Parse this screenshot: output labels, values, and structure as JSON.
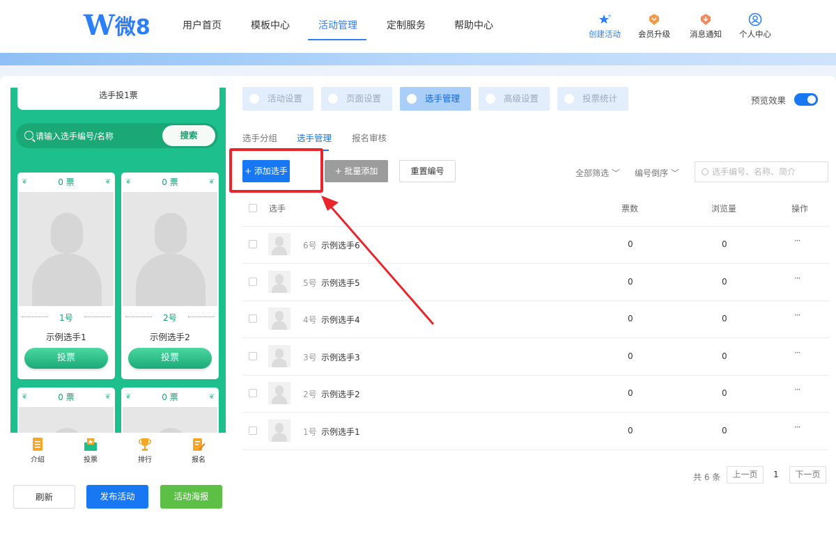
{
  "header": {
    "logo_mark": "W",
    "logo_text": "微8",
    "nav": [
      {
        "label": "用户首页"
      },
      {
        "label": "模板中心"
      },
      {
        "label": "活动管理",
        "active": true
      },
      {
        "label": "定制服务"
      },
      {
        "label": "帮助中心"
      }
    ],
    "actions": [
      {
        "label": "创建活动",
        "icon": "star-plus-icon"
      },
      {
        "label": "会员升级",
        "icon": "diamond-badge-icon"
      },
      {
        "label": "消息通知",
        "icon": "bell-badge-icon"
      },
      {
        "label": "个人中心",
        "icon": "user-circle-icon"
      }
    ]
  },
  "preview": {
    "title": "选手投1票",
    "search_placeholder": "请输入选手编号/名称",
    "search_button": "搜索",
    "cards": [
      {
        "votes": "0 票",
        "number": "1号",
        "name": "示例选手1",
        "button": "投票"
      },
      {
        "votes": "0 票",
        "number": "2号",
        "name": "示例选手2",
        "button": "投票"
      },
      {
        "votes": "0 票"
      },
      {
        "votes": "0 票"
      }
    ],
    "bottom_tabs": [
      {
        "label": "介绍",
        "icon": "document-icon"
      },
      {
        "label": "投票",
        "icon": "ballot-box-icon"
      },
      {
        "label": "排行",
        "icon": "trophy-icon"
      },
      {
        "label": "报名",
        "icon": "edit-form-icon"
      }
    ]
  },
  "left_buttons": {
    "refresh": "刷新",
    "publish": "发布活动",
    "poster": "活动海报"
  },
  "steps": [
    {
      "label": "活动设置"
    },
    {
      "label": "页面设置"
    },
    {
      "label": "选手管理",
      "active": true
    },
    {
      "label": "高级设置"
    },
    {
      "label": "投票统计"
    }
  ],
  "preview_toggle": {
    "label": "预览效果",
    "on": true
  },
  "subtabs": [
    {
      "label": "选手分组"
    },
    {
      "label": "选手管理",
      "active": true
    },
    {
      "label": "报名审核"
    }
  ],
  "toolbar": {
    "add": "+ 添加选手",
    "batch": "+ 批量添加",
    "reset": "重置编号",
    "filter_all": "全部筛选 ﹀",
    "filter_order": "编号倒序 ﹀",
    "search_placeholder": "选手编号、名称、简介"
  },
  "table": {
    "headers": {
      "player": "选手",
      "votes": "票数",
      "views": "浏览量",
      "actions": "操作"
    },
    "rows": [
      {
        "number": "6号",
        "name": "示例选手6",
        "votes": "0",
        "views": "0",
        "more": "···"
      },
      {
        "number": "5号",
        "name": "示例选手5",
        "votes": "0",
        "views": "0",
        "more": "···"
      },
      {
        "number": "4号",
        "name": "示例选手4",
        "votes": "0",
        "views": "0",
        "more": "···"
      },
      {
        "number": "3号",
        "name": "示例选手3",
        "votes": "0",
        "views": "0",
        "more": "···"
      },
      {
        "number": "2号",
        "name": "示例选手2",
        "votes": "0",
        "views": "0",
        "more": "···"
      },
      {
        "number": "1号",
        "name": "示例选手1",
        "votes": "0",
        "views": "0",
        "more": "···"
      }
    ]
  },
  "pagination": {
    "total": "共 6 条",
    "prev": "上一页",
    "current": "1",
    "next": "下一页"
  },
  "colors": {
    "primary": "#1877f2",
    "green": "#1dbf8c",
    "annotation_red": "#e8262c"
  }
}
